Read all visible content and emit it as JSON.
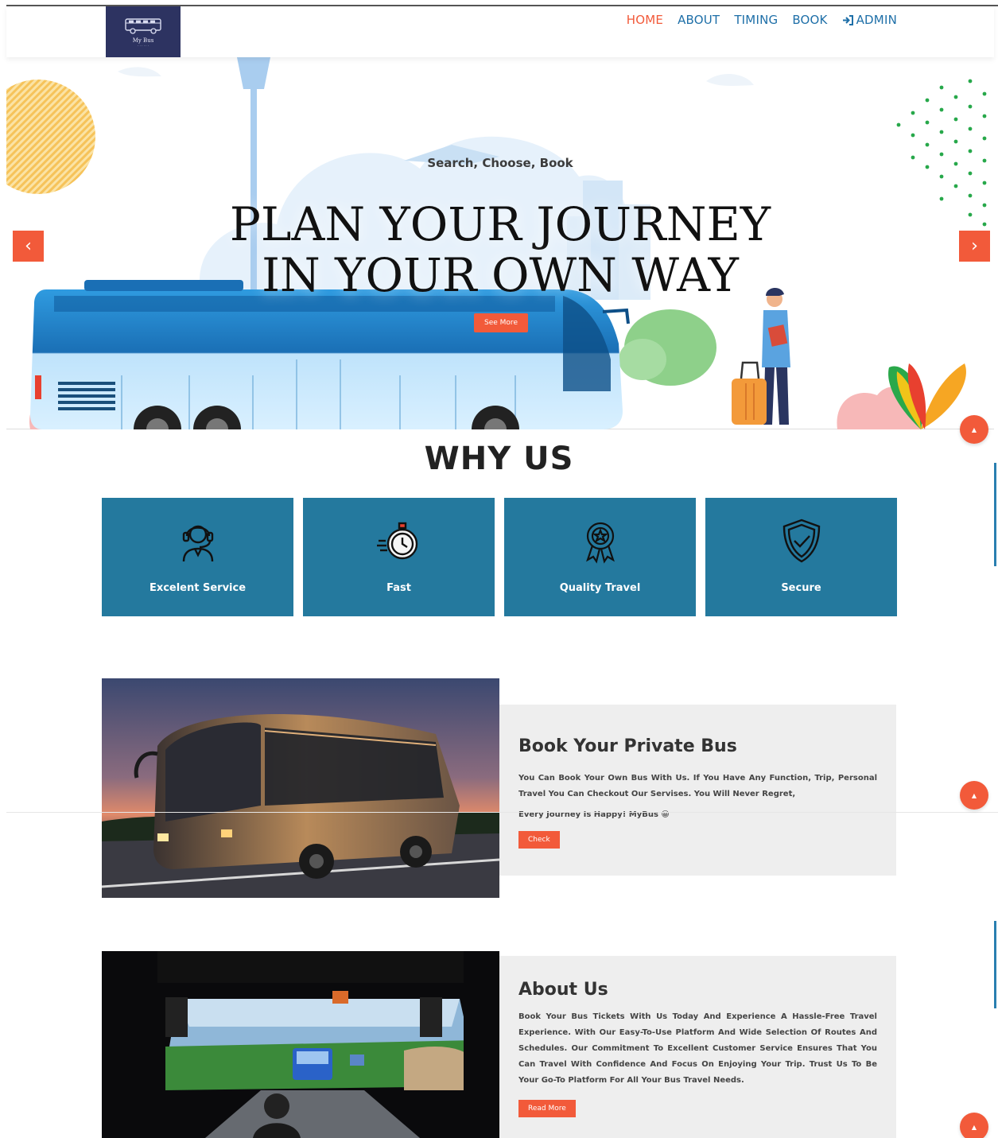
{
  "brand": {
    "name": "My Bus"
  },
  "nav": {
    "items": [
      "HOME",
      "ABOUT",
      "TIMING",
      "BOOK"
    ],
    "admin_label": "ADMIN",
    "active": "HOME"
  },
  "hero": {
    "tagline": "Search, Choose, Book",
    "title_line1": "PLAN YOUR JOURNEY",
    "title_line2": "IN YOUR OWN WAY",
    "see_more_label": "See More",
    "prev_icon": "chevron-left-icon",
    "next_icon": "chevron-right-icon"
  },
  "why_us": {
    "title": "WHY US",
    "features": [
      {
        "label": "Excelent Service",
        "icon": "headset-agent-icon"
      },
      {
        "label": "Fast",
        "icon": "stopwatch-icon"
      },
      {
        "label": "Quality Travel",
        "icon": "award-badge-icon"
      },
      {
        "label": "Secure",
        "icon": "shield-check-icon"
      }
    ]
  },
  "private_bus": {
    "title": "Book Your Private Bus",
    "text": "You Can Book Your Own Bus With Us. If You Have Any Function, Trip, Personal Travel You Can Checkout Our Servises. You Will Never Regret,",
    "text2": "Every Journey Is Happy! MyBus 😀",
    "button_label": "Check"
  },
  "about": {
    "title": "About Us",
    "text": "Book Your Bus Tickets With Us Today And Experience A Hassle-Free Travel Experience. With Our Easy-To-Use Platform And Wide Selection Of Routes And Schedules. Our Commitment To Excellent Customer Service Ensures That You Can Travel With Confidence And Focus On Enjoying Your Trip. Trust Us To Be Your Go-To Platform For All Your Bus Travel Needs.",
    "button_label": "Read More"
  },
  "colors": {
    "accent": "#f25a3a",
    "nav_link": "#1e6fa8",
    "feature_bg": "#24799e",
    "logo_bg": "#2d3361",
    "panel_bg": "#eeeeee"
  }
}
